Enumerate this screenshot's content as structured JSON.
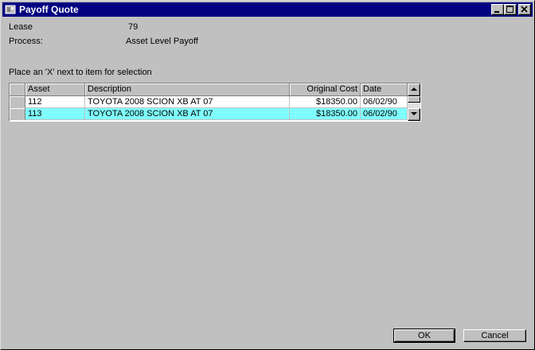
{
  "window": {
    "title": "Payoff Quote"
  },
  "fields": {
    "lease_label": "Lease",
    "lease_value": "79",
    "process_label": "Process:",
    "process_value": "Asset Level Payoff"
  },
  "instruction": "Place an 'X' next to item for selection",
  "table": {
    "columns": [
      "Asset",
      "Description",
      "Original Cost",
      "Date"
    ],
    "rows": [
      {
        "asset": "112",
        "description": "TOYOTA 2008 SCION XB AT 07",
        "cost": "$18350.00",
        "date": "06/02/90",
        "selected": false
      },
      {
        "asset": "113",
        "description": "TOYOTA 2008 SCION XB AT 07",
        "cost": "$18350.00",
        "date": "06/02/90",
        "selected": true
      }
    ]
  },
  "buttons": {
    "ok": "OK",
    "cancel": "Cancel"
  },
  "colors": {
    "titlebar": "#000080",
    "selected_row": "#80ffff",
    "window_bg": "#c0c0c0"
  },
  "icons": {
    "app": "app-icon",
    "minimize": "minimize-icon",
    "maximize": "maximize-icon",
    "close": "close-icon"
  }
}
